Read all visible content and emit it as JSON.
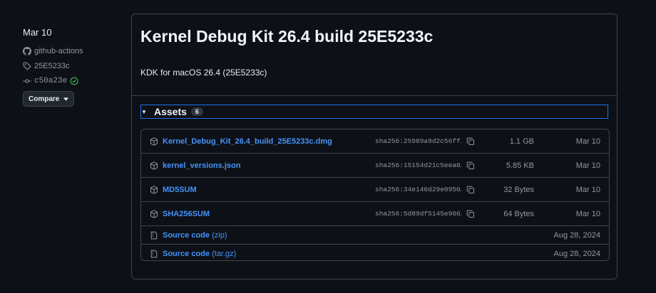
{
  "sidebar": {
    "date": "Mar 10",
    "author": "github-actions",
    "tag": "25E5233c",
    "commit": "c50a23e",
    "compare_label": "Compare"
  },
  "release": {
    "title": "Kernel Debug Kit 26.4 build 25E5233c",
    "description": "KDK for macOS 26.4 (25E5233c)"
  },
  "assets": {
    "label": "Assets",
    "count": "6",
    "files": [
      {
        "name": "Kernel_Debug_Kit_26.4_build_25E5233c.dmg",
        "sha": "sha256:25989a9d2c56ff…",
        "size": "1.1 GB",
        "date": "Mar 10"
      },
      {
        "name": "kernel_versions.json",
        "sha": "sha256:15154d21c5eea0…",
        "size": "5.85 KB",
        "date": "Mar 10"
      },
      {
        "name": "MD5SUM",
        "sha": "sha256:34e140d29e0950…",
        "size": "32 Bytes",
        "date": "Mar 10"
      },
      {
        "name": "SHA256SUM",
        "sha": "sha256:5d89df5145e966…",
        "size": "64 Bytes",
        "date": "Mar 10"
      }
    ],
    "sources": [
      {
        "name": "Source code",
        "suffix": "(zip)",
        "date": "Aug 28, 2024"
      },
      {
        "name": "Source code",
        "suffix": "(tar.gz)",
        "date": "Aug 28, 2024"
      }
    ]
  },
  "colors": {
    "background": "#0d1117",
    "link": "#4493f8",
    "border": "#3d444d",
    "success": "#3fb950",
    "focus": "#1f6feb"
  },
  "icons": [
    "github-mark-icon",
    "tag-icon",
    "commit-icon",
    "check-circle-icon",
    "triangle-down-icon",
    "package-icon",
    "copy-icon",
    "file-zip-icon"
  ]
}
